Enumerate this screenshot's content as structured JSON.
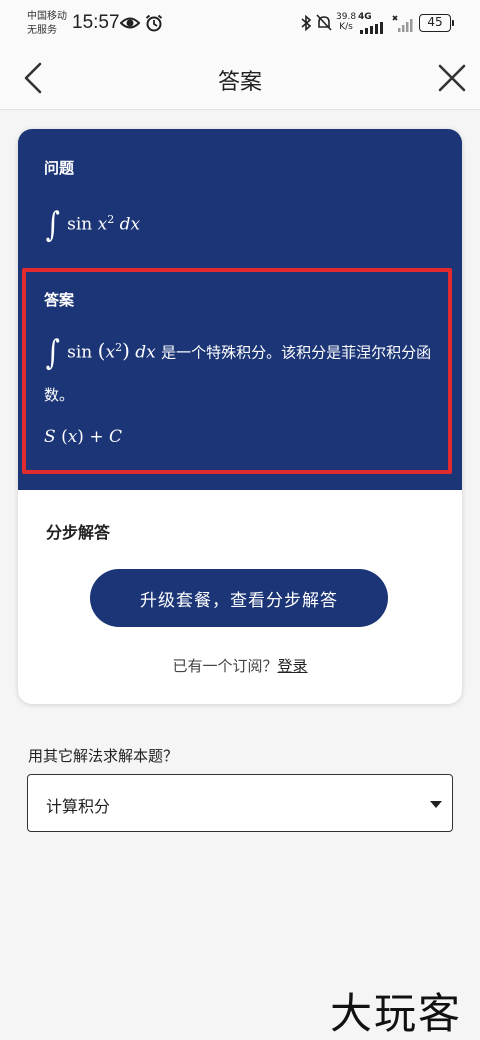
{
  "status_bar": {
    "carrier_line1": "中国移动",
    "carrier_line2": "无服务",
    "time": "15:57",
    "net_speed_value": "39.8",
    "net_speed_unit": "K/s",
    "net_type": "4G",
    "battery": "45"
  },
  "header": {
    "title": "答案"
  },
  "card": {
    "question_label": "问题",
    "question_expr": {
      "integral": "∫",
      "func": "sin",
      "var": "x",
      "power": "2",
      "diff": "dx"
    },
    "answer_label": "答案",
    "answer_expr": {
      "integral": "∫",
      "func": "sin",
      "open": "(",
      "var": "x",
      "power": "2",
      "close": ")",
      "diff": "dx"
    },
    "answer_text_1": "是一个特殊积分。该积分是菲涅尔积分函",
    "answer_text_2": "数。",
    "answer_result": {
      "fn": "S",
      "open": "(",
      "var": "x",
      "close": ")",
      "plus": "+",
      "const": "C"
    },
    "steps_title": "分步解答",
    "upgrade_button": "升级套餐，查看分步解答",
    "login_prompt": "已有一个订阅？",
    "login_link": "登录"
  },
  "other_methods": {
    "title": "用其它解法求解本题？",
    "selected": "计算积分"
  },
  "watermark": "大玩客",
  "colors": {
    "primary": "#1b3577",
    "highlight_border": "#e12b2f",
    "background": "#f5f5f5"
  }
}
